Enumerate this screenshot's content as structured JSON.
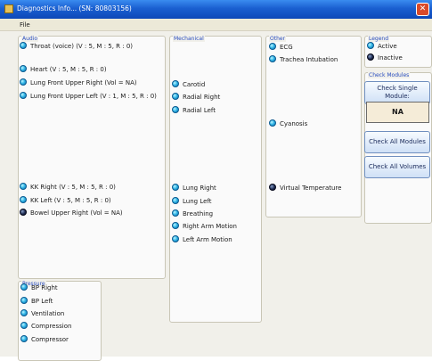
{
  "window": {
    "title": "Diagnostics Info... (SN: 80803156)",
    "close_glyph": "✕"
  },
  "menu": {
    "file": "File"
  },
  "audio": {
    "title": "Audio",
    "items": [
      {
        "label": "Throat (voice) (V : 5, M : 5, R : 0)",
        "state": "active"
      },
      {
        "label": "Heart (V : 5, M : 5, R : 0)",
        "state": "active"
      },
      {
        "label": "Lung Front Upper Right (Vol = NA)",
        "state": "active"
      },
      {
        "label": "Lung Front Upper Left (V : 1, M : 5, R : 0)",
        "state": "active"
      },
      {
        "label": "KK Right (V : 5, M : 5, R : 0)",
        "state": "active"
      },
      {
        "label": "KK Left (V : 5, M : 5, R : 0)",
        "state": "active"
      },
      {
        "label": "Bowel Upper Right (Vol = NA)",
        "state": "inactive"
      }
    ]
  },
  "mechanical": {
    "title": "Mechanical",
    "items": [
      {
        "label": "Carotid",
        "state": "active"
      },
      {
        "label": "Radial Right",
        "state": "active"
      },
      {
        "label": "Radial Left",
        "state": "active"
      },
      {
        "label": "Lung Right",
        "state": "active"
      },
      {
        "label": "Lung Left",
        "state": "active"
      },
      {
        "label": "Breathing",
        "state": "active"
      },
      {
        "label": "Right Arm Motion",
        "state": "active"
      },
      {
        "label": "Left Arm Motion",
        "state": "active"
      }
    ]
  },
  "other": {
    "title": "Other",
    "items": [
      {
        "label": "ECG",
        "state": "active"
      },
      {
        "label": "Trachea Intubation",
        "state": "active"
      },
      {
        "label": "Cyanosis",
        "state": "active"
      },
      {
        "label": "Virtual Temperature",
        "state": "inactive"
      }
    ]
  },
  "legend": {
    "title": "Legend",
    "active": "Active",
    "inactive": "Inactive"
  },
  "check_modules": {
    "title": "Check Modules",
    "single_button": "Check Single Module:",
    "single_value": "NA",
    "all_modules_button": "Check All Modules",
    "all_volumes_button": "Check All Volumes"
  },
  "pressure": {
    "title": "Pressure",
    "items": [
      {
        "label": "BP Right",
        "state": "active"
      },
      {
        "label": "BP Left",
        "state": "active"
      },
      {
        "label": "Ventilation",
        "state": "active"
      },
      {
        "label": "Compression",
        "state": "active"
      },
      {
        "label": "Compressor",
        "state": "active"
      }
    ]
  },
  "colors": {
    "active": "#35b8e8",
    "inactive": "#1c2a50",
    "titlebar": "#1a5fd0",
    "section_title": "#2a4ec0"
  }
}
